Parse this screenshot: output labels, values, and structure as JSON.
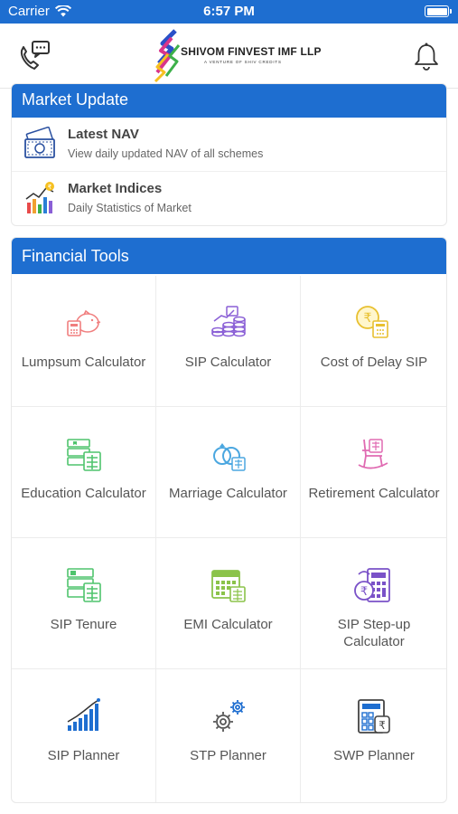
{
  "status_bar": {
    "carrier": "Carrier",
    "time": "6:57 PM"
  },
  "header": {
    "brand": "SHIVOM FINVEST IMF LLP",
    "tagline": "A VENTURE OF SHIV CREDITS",
    "left_icon": "phone-chat-icon",
    "right_icon": "bell-icon"
  },
  "market_update": {
    "title": "Market Update",
    "items": [
      {
        "title": "Latest NAV",
        "subtitle": "View daily updated NAV of all schemes",
        "icon": "money-icon"
      },
      {
        "title": "Market Indices",
        "subtitle": "Daily Statistics of Market",
        "icon": "chart-growth-icon"
      }
    ]
  },
  "financial_tools": {
    "title": "Financial Tools",
    "tools": [
      {
        "label": "Lumpsum Calculator",
        "icon": "piggy-bank-icon",
        "color": "#f07f7f"
      },
      {
        "label": "SIP Calculator",
        "icon": "coins-stack-icon",
        "color": "#8a5fd6"
      },
      {
        "label": "Cost of Delay SIP",
        "icon": "rupee-clock-icon",
        "color": "#e8c030"
      },
      {
        "label": "Education Calculator",
        "icon": "education-icon",
        "color": "#4fc46d"
      },
      {
        "label": "Marriage Calculator",
        "icon": "rings-icon",
        "color": "#4ba7e0"
      },
      {
        "label": "Retirement Calculator",
        "icon": "rocking-chair-icon",
        "color": "#e06bb2"
      },
      {
        "label": "SIP Tenure",
        "icon": "tenure-calculator-icon",
        "color": "#4fc46d"
      },
      {
        "label": "EMI Calculator",
        "icon": "calendar-calc-icon",
        "color": "#8bc34a"
      },
      {
        "label": "SIP Step-up Calculator",
        "icon": "rupee-calculator-icon",
        "color": "#7a52c8"
      },
      {
        "label": "SIP Planner",
        "icon": "bar-growth-icon",
        "color": "#1e6ed0"
      },
      {
        "label": "STP Planner",
        "icon": "gears-icon",
        "color": "#1e6ed0"
      },
      {
        "label": "SWP Planner",
        "icon": "calculator-rupee-icon",
        "color": "#1e6ed0"
      }
    ]
  }
}
